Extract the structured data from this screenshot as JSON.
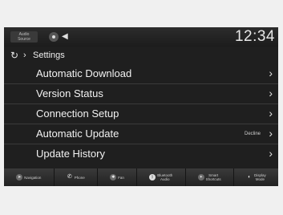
{
  "status_bar": {
    "audio_source": "Audio\nSource",
    "clock": "12:34"
  },
  "breadcrumb": {
    "title": "Settings"
  },
  "menu": {
    "items": [
      {
        "label": "Automatic Download",
        "value": ""
      },
      {
        "label": "Version Status",
        "value": ""
      },
      {
        "label": "Connection Setup",
        "value": ""
      },
      {
        "label": "Automatic Update",
        "value": "Decline"
      },
      {
        "label": "Update History",
        "value": ""
      }
    ]
  },
  "bottom_bar": {
    "items": [
      {
        "label": "Navigation",
        "icon": "navigation-icon"
      },
      {
        "label": "Phone",
        "icon": "phone-icon"
      },
      {
        "label": "Fan",
        "icon": "fan-icon"
      },
      {
        "label": "Bluetooth\nAudio",
        "icon": "bluetooth-icon"
      },
      {
        "label": "Smart\nShortcuts",
        "icon": "shortcuts-icon"
      },
      {
        "label": "Display\nMode",
        "icon": "display-mode-icon"
      }
    ]
  }
}
